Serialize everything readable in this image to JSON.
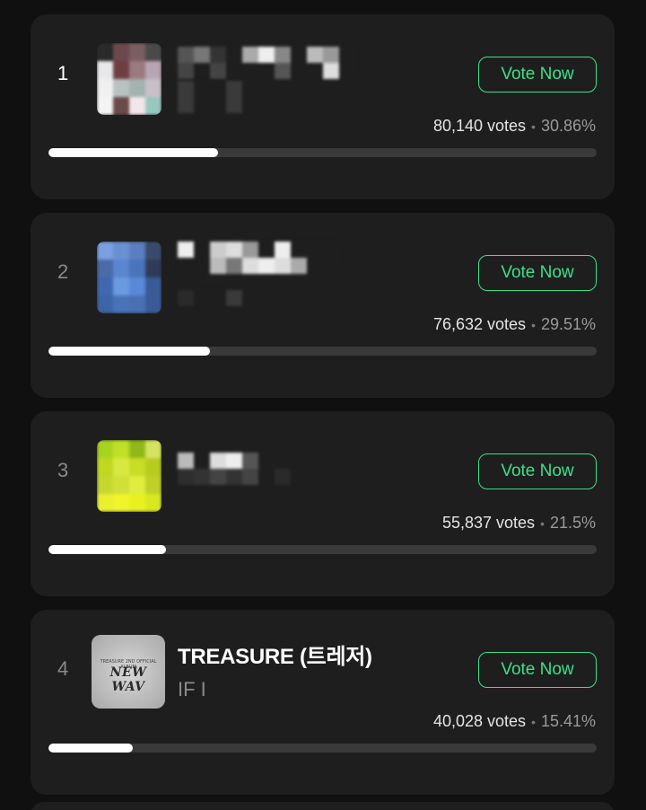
{
  "entries": [
    {
      "rank": "1",
      "votes": "80,140 votes",
      "percent": "30.86%",
      "progress": 0.3086,
      "vote_label": "Vote Now",
      "censored": true
    },
    {
      "rank": "2",
      "votes": "76,632 votes",
      "percent": "29.51%",
      "progress": 0.2951,
      "vote_label": "Vote Now",
      "censored": true
    },
    {
      "rank": "3",
      "votes": "55,837 votes",
      "percent": "21.5%",
      "progress": 0.215,
      "vote_label": "Vote Now",
      "censored": true
    },
    {
      "rank": "4",
      "title": "TREASURE (트레저)",
      "subtitle": "IF I",
      "votes": "40,028 votes",
      "percent": "15.41%",
      "progress": 0.1541,
      "vote_label": "Vote Now",
      "album_text": "NEW WAV",
      "album_small_text": "TREASURE 2ND OFFICIAL ALBUM"
    }
  ],
  "separator": "•",
  "colors": {
    "background": "#101010",
    "card": "#1e1e1e",
    "accent": "#3ee08a",
    "bar_track": "#3a3a3a",
    "bar_fill": "#ffffff"
  }
}
